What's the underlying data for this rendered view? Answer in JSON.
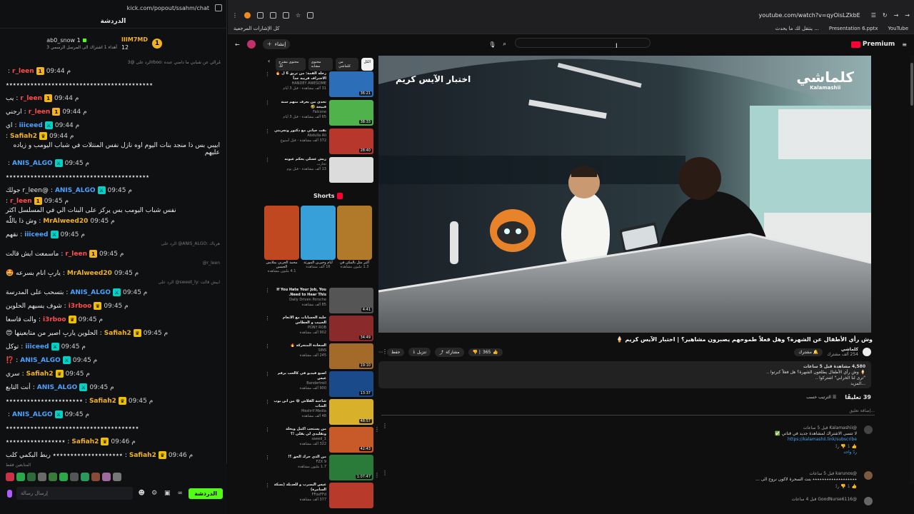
{
  "chat": {
    "url": "kick.com/popout/ssahm/chat",
    "title": "الدردشة",
    "pinned": {
      "user1": "IIIM7MD",
      "user1_count": "12",
      "user2": "ab0_snow",
      "user2_count": "1",
      "subtitle": "أهداء 1 اشتراك الى المرسل الرسمي 3"
    },
    "reply_banner": "الرد على @3rboo: مُرالي عن شبابي ما دامني عنده",
    "messages": [
      {
        "time": "09:44 م",
        "user": "r_leen",
        "color": "#ff4b4b",
        "text": "",
        "badges": [
          "sub"
        ]
      },
      {
        "time": "",
        "user": "",
        "color": "#ececec",
        "text": "٭٭٭٭٭٭٭٭٭٭٭٭٭٭٭٭٭٭٭٭٭٭٭٭٭٭٭٭٭٭٭٭٭٭٭٭٭٭٭٭٭٭",
        "badges": []
      },
      {
        "time": "09:44 م",
        "user": "r_leen",
        "color": "#ff4b4b",
        "text": "يب",
        "badges": [
          "sub"
        ]
      },
      {
        "time": "09:44 م",
        "user": "r_leen",
        "color": "#ff4b4b",
        "text": "ارجني",
        "badges": [
          "sub"
        ]
      },
      {
        "time": "09:44 م",
        "user": "iiiceed",
        "color": "#4aa3ff",
        "text": "اي",
        "badges": [
          "mod"
        ]
      },
      {
        "time": "09:44 م",
        "user": "Safiah2",
        "color": "#f2b31c",
        "text": "ابيبي بس ذا منجد بنات اليوم اوه نازل نفس المنتلات في شباب اليومب و زياده عليهم",
        "badges": [
          "crown"
        ]
      },
      {
        "time": "09:45 م",
        "user": "ANIS_ALGO",
        "color": "#4aa3ff",
        "text": "",
        "badges": [
          "mod"
        ]
      },
      {
        "time": "",
        "user": "",
        "color": "#ececec",
        "text": "٭٭٭٭٭٭٭٭٭٭٭٭٭٭٭٭٭٭٭٭٭٭٭٭٭٭٭٭٭٭٭٭٭٭٭٭٭٭٭٭٭",
        "badges": []
      },
      {
        "time": "09:45 م",
        "user": "ANIS_ALGO",
        "color": "#4aa3ff",
        "text": "@r_leen جولك",
        "badges": [
          "mod"
        ]
      },
      {
        "time": "09:45 م",
        "user": "r_leen",
        "color": "#ff4b4b",
        "text": "نفس شباب اليومب بس يركز على البنات الي في المسلسل اكثر",
        "badges": [
          "sub"
        ]
      },
      {
        "time": "09:45 م",
        "user": "MrAlweed20",
        "color": "#f2b31c",
        "text": "وش ذا باللّه",
        "badges": []
      },
      {
        "time": "09:45 م",
        "user": "iiiceed",
        "color": "#4aa3ff",
        "text": "نقهم",
        "badges": [
          "mod"
        ]
      },
      {
        "time": "09:45 م",
        "user": "r_leen",
        "color": "#ff4b4b",
        "text": "ماسمعت ايش قالت",
        "badges": [
          "sub"
        ],
        "reply": "الرد على @ANIS_ALGO: هرباك"
      },
      {
        "time": "09:45 م",
        "user": "MrAlweed20",
        "color": "#f2b31c",
        "text": "ياربِ انام بسرعه 🤩",
        "badges": [],
        "reply": "@r_leen"
      },
      {
        "time": "09:45 م",
        "user": "ANIS_ALGO",
        "color": "#4aa3ff",
        "text": "بتسحب على المدرسة",
        "badges": [
          "mod"
        ],
        "reply": "الرد على @sweet_ly: ابيش قالت"
      },
      {
        "time": "09:45 م",
        "user": "i3rboo",
        "color": "#ff4b4b",
        "text": "شوف يسيهم الحلوين",
        "badges": [
          "crown"
        ]
      },
      {
        "time": "09:45 م",
        "user": "i3rboo",
        "color": "#ff4b4b",
        "text": "والت قاسعا",
        "badges": [
          "crown"
        ]
      },
      {
        "time": "09:45 م",
        "user": "Safiah2",
        "color": "#f2b31c",
        "text": "الحلوين ياربِ اصير من متابعينها 😍",
        "badges": [
          "crown"
        ]
      },
      {
        "time": "09:45 م",
        "user": "iiiceed",
        "color": "#4aa3ff",
        "text": "توكل",
        "badges": [
          "mod"
        ]
      },
      {
        "time": "09:45 م",
        "user": "ANIS_ALGO",
        "color": "#4aa3ff",
        "text": "⁉️",
        "badges": [
          "mod"
        ]
      },
      {
        "time": "09:45 م",
        "user": "Safiah2",
        "color": "#f2b31c",
        "text": "سري",
        "badges": [
          "crown"
        ]
      },
      {
        "time": "09:45 م",
        "user": "ANIS_ALGO",
        "color": "#4aa3ff",
        "text": "أنت التابع",
        "badges": [
          "mod"
        ]
      },
      {
        "time": "09:45 م",
        "user": "Safiah2",
        "color": "#f2b31c",
        "text": "٭٭٭٭٭٭٭٭٭٭٭٭٭٭٭٭٭٭٭٭٭٭",
        "badges": [
          "crown"
        ]
      },
      {
        "time": "09:45 م",
        "user": "ANIS_ALGO",
        "color": "#4aa3ff",
        "text": "",
        "badges": [
          "mod"
        ]
      },
      {
        "time": "",
        "user": "",
        "color": "#ececec",
        "text": "٭٭٭٭٭٭٭٭٭٭٭٭٭٭٭٭٭٭٭٭٭٭٭٭٭٭٭٭٭٭٭٭٭٭٭٭٭٭",
        "badges": []
      },
      {
        "time": "09:46 م",
        "user": "Safiah2",
        "color": "#f2b31c",
        "text": "٭٭٭٭٭٭٭٭٭٭٭٭٭٭٭٭٭",
        "badges": [
          "crown"
        ]
      },
      {
        "time": "09:46 م",
        "user": "Safiah2",
        "color": "#f2b31c",
        "text": "٭٭٭٭٭٭٭٭٭٭٭٭٭٭٭٭٭٭٭٭ ربط البكمي كلب",
        "badges": [
          "crown"
        ]
      },
      {
        "time": "09:46 م",
        "user": "MrAlweed20",
        "color": "#f2b31c",
        "text": "😂 😂 😂 😂 😂",
        "badges": []
      }
    ],
    "viewers_label": "المتابعين فقط",
    "input_placeholder": "إرسال رسالة",
    "send_label": "الدردشة"
  },
  "browser": {
    "url": "youtube.com/watch?v=qyOisLZkbE",
    "bookmarks": [
      "YouTube",
      "Presentation 6.pptx",
      "ينتقل لك ما يحدث ...",
      "كل الإشارات المرجعية"
    ],
    "premium_label": "Premium",
    "create_label": "إنشاء"
  },
  "video": {
    "overlay_title": "اختبار الآيس كريم",
    "logo_main": "كلماشي",
    "logo_sub": "Kalamashii",
    "title": "وش رأي الأطفال عن الشهرة؟ وهل فعلاً طموحهم يصبرون مشاهير؟ | اختبار الآيس كريم 🍦",
    "channel": "كلماشي",
    "subs": "254 ألف مشترك",
    "subscribe_label": "مشترك",
    "likes": "365",
    "share_label": "مشاركة",
    "download_label": "تنزيل",
    "save_label": "حفظ",
    "desc_line1": "4,580 مشاهدة  قبل 5 ساعات",
    "desc_line2": "🍦 وش رأي الأطفال يطلعون الشهرة؟ هل فعلاً كبرتوا ..",
    "desc_line3": "\"ترى لنا الخرابي\" اشتركوا ..",
    "desc_more": "...المزيد",
    "comments_count": "39 تعليقًا",
    "sort_label": "الترتيب حسب",
    "add_comment": "إضافة تعليق...",
    "comment1_author": "@Kalamashii  قبل 5 ساعات",
    "comment1_text": "لا تنسى الاشتراك لمشاهدة جديد في قناتي ✅",
    "comment1_link": "https://kalamashii.link/subscribe",
    "comment1_replies": "ردّ واحد",
    "comment2_author": "@karunos  قبل 5 ساعات",
    "comment2_text": "٭٭٭٭٭٭٭٭٭٭٭٭٭٭٭٭٭٭٭ بنت السحرة لاكون نروح الى ...",
    "comment3_author": "@GoodNurse6116  قبل 4 ساعات"
  },
  "sidebar": {
    "chips": [
      "الكل",
      "من كلماشي",
      "محتوى مشابه",
      "محتوى مقترح لك"
    ],
    "recs": [
      {
        "title": "رحلة القمة: من تريق 6 ل 🔥 الاحتراف قريبة جداً",
        "channel": "HANDEY AWESOME",
        "views": "31 ألف مشاهدة - قبل 3 أيام",
        "dur": "36:21",
        "color": "#2c6fb8"
      },
      {
        "title": "تحدي من يعرف منهم سنة قبيحة 🤣",
        "channel": "Falcone",
        "views": "65 ألف مشاهدة - قبل 3 أيام",
        "dur": "38:33",
        "color": "#4fb24b"
      },
      {
        "title": "بقت حياتي مع دكتور وتجربتي",
        "channel": "Abdulla Ali",
        "views": "372 ألف مشاهدة - قبل أسبوع",
        "dur": "28:40",
        "color": "#b8372c"
      },
      {
        "title": "ريش عسلي يحكم عيونه",
        "channel": "تجارب",
        "views": "13 ألف مشاهدة - قبل يوم",
        "dur": "",
        "color": "#dcdcdc"
      }
    ],
    "shorts_label": "Shorts",
    "shorts": [
      {
        "cap": "أكبر مثل بالمكن في",
        "views": "1.3 مليون مشاهدة",
        "color": "#b07a2a"
      },
      {
        "cap": "أيام وحيرين المورثة",
        "views": "16 ألف مشاهدة",
        "color": "#38a0d8"
      },
      {
        "cap": "محمد الحربي بملابس الحمس",
        "views": "4.1 مليون مشاهدة",
        "color": "#c04820"
      }
    ],
    "recs2": [
      {
        "title": "If You Hate Your Job, You Need to Hear This.",
        "channel": "Daily Driven Porsche",
        "views": "85 ألف مشاهدة",
        "dur": "4:41",
        "color": "#555"
      },
      {
        "title": "جلبة الحسابات مع الأنعام الحبيب و العطاس",
        "channel": "PONY ROB",
        "views": "902 ألف مشاهدة",
        "dur": "34:49",
        "color": "#8a2a2a"
      },
      {
        "title": "السعادة المتحركة 🔥",
        "channel": "SINS",
        "views": "245 ألف مشاهدة",
        "dur": "19:10",
        "color": "#a46a2a"
      },
      {
        "title": "اصنع فيديو في كالحب برقم عيس",
        "channel": "Bandertrell",
        "views": "900 ألف مشاهدة",
        "dur": "13:37",
        "color": "#1a4a8a"
      },
      {
        "title": "شاحنة القلاش 😂 من ابن بوب الشاب",
        "channel": "Meshrif Media",
        "views": "48 ألف مشاهدة",
        "dur": "48:57",
        "color": "#d8b02a"
      },
      {
        "title": "من يستحب اكمل ويخلة وتقليدي لي يقلي !؟",
        "channel": "saeed_1",
        "views": "322 ألف مشاهدة",
        "dur": "42:43",
        "color": "#c85a2a"
      },
      {
        "title": "من الذي حرك الحق ؟!",
        "channel": "FZX 9",
        "views": "1.7 مليون مشاهدة",
        "dur": "1:07:47",
        "color": "#2a7a3a"
      },
      {
        "title": "عيس البسرب و للعديلة (بسكة السامرة)",
        "channel": "FFoxFFd",
        "views": "377 ألف مشاهدة",
        "dur": "",
        "color": "#b83a2a"
      }
    ]
  }
}
